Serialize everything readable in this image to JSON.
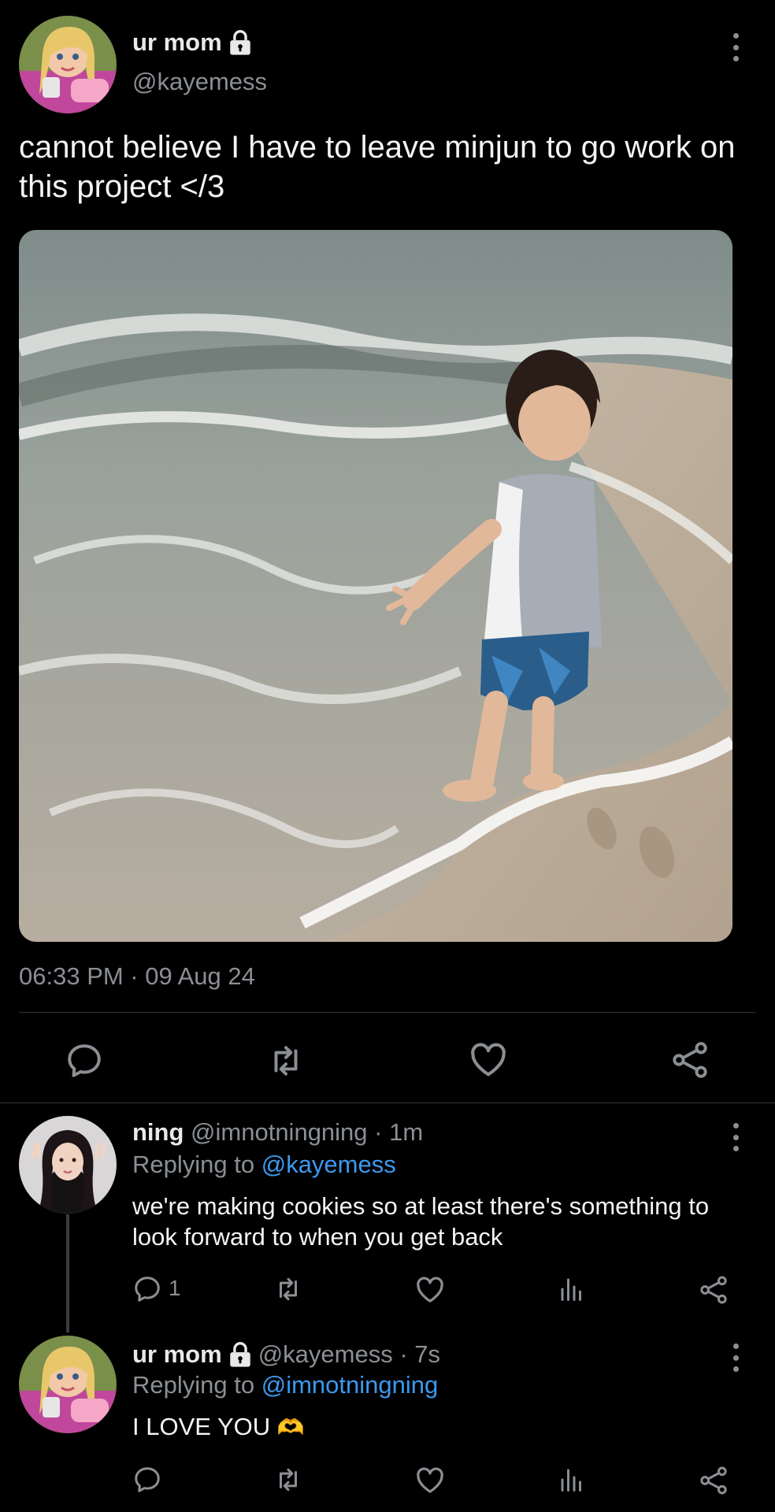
{
  "main_tweet": {
    "display_name": "ur mom",
    "handle": "@kayemess",
    "text": "cannot believe I have to leave minjun to go work on this project </3",
    "timestamp": "06:33 PM · 09 Aug 24",
    "icons": [
      "lock-icon",
      "more-options-icon",
      "reply-icon",
      "retweet-icon",
      "like-icon",
      "share-icon"
    ]
  },
  "reply_1": {
    "display_name": "ning",
    "handle": "@imnotningning",
    "time": " · 1m",
    "replying_prefix": "Replying to ",
    "replying_handle": "@kayemess",
    "text": "we're making cookies so at least there's something to look forward to when you get back",
    "reply_count": "1"
  },
  "reply_2": {
    "display_name": "ur mom",
    "handle": "@kayemess",
    "time": " · 7s",
    "replying_prefix": "Replying to ",
    "replying_handle": "@imnotningning",
    "text": "I LOVE YOU",
    "emoji": "🫶"
  },
  "colors": {
    "background": "#000000",
    "text": "#e7e9ea",
    "muted": "#8b8f94",
    "link": "#3b99f0",
    "divider": "#2f3336"
  }
}
